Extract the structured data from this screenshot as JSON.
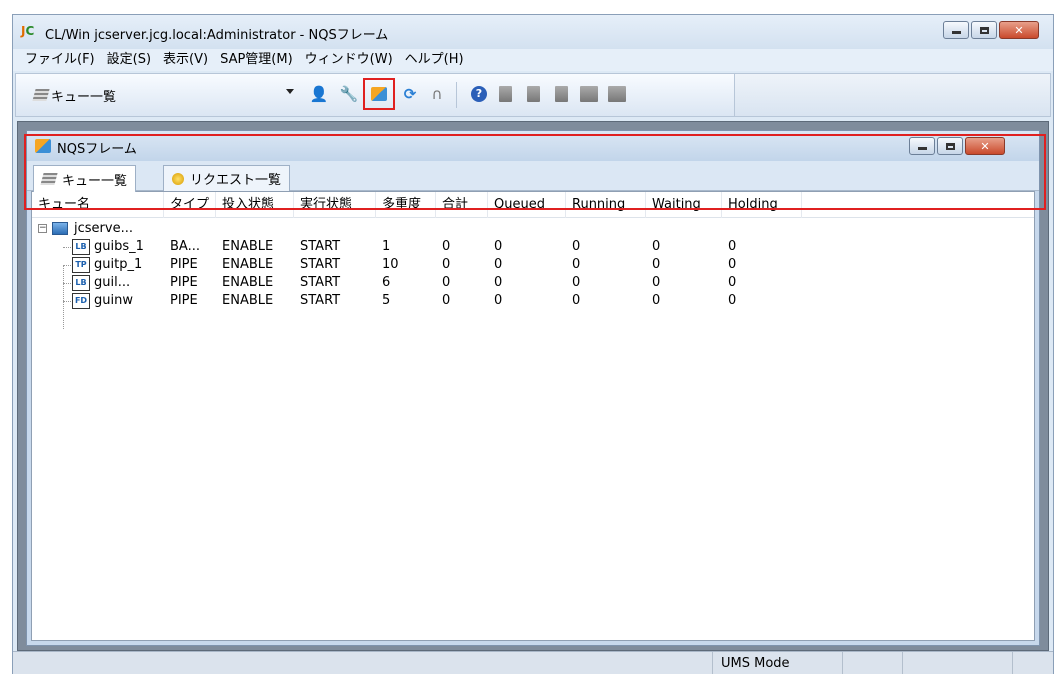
{
  "window": {
    "logo": "JC",
    "title": "CL/Win jcserver.jcg.local:Administrator - NQSフレーム"
  },
  "menu": [
    "ファイル(F)",
    "設定(S)",
    "表示(V)",
    "SAP管理(M)",
    "ウィンドウ(W)",
    "ヘルプ(H)"
  ],
  "toolbar": {
    "combo_value": "キュー一覧",
    "buttons": [
      "user-icon",
      "tools-icon",
      "nqs-frame-icon",
      "refresh-icon",
      "stop-icon",
      "help-icon",
      "doc-icon",
      "doc2-icon",
      "doc3-icon",
      "job-icon",
      "transfer-icon"
    ]
  },
  "inner": {
    "title": "NQSフレーム",
    "tabs": [
      {
        "label": "キュー一覧",
        "active": true
      },
      {
        "label": "リクエスト一覧",
        "active": false
      }
    ]
  },
  "table": {
    "headers": [
      "キュー名",
      "タイプ",
      "投入状態",
      "実行状態",
      "多重度",
      "合計",
      "Queued",
      "Running",
      "Waiting",
      "Holding"
    ],
    "server": "jcserve...",
    "rows": [
      {
        "icon": "LB",
        "name": "guibs_1",
        "type": "BA...",
        "submit": "ENABLE",
        "run": "START",
        "multi": "1",
        "total": "0",
        "queued": "0",
        "running": "0",
        "waiting": "0",
        "holding": "0"
      },
      {
        "icon": "TP",
        "name": "guitp_1",
        "type": "PIPE",
        "submit": "ENABLE",
        "run": "START",
        "multi": "10",
        "total": "0",
        "queued": "0",
        "running": "0",
        "waiting": "0",
        "holding": "0"
      },
      {
        "icon": "LB",
        "name": "guil...",
        "type": "PIPE",
        "submit": "ENABLE",
        "run": "START",
        "multi": "6",
        "total": "0",
        "queued": "0",
        "running": "0",
        "waiting": "0",
        "holding": "0"
      },
      {
        "icon": "FD",
        "name": "guinw",
        "type": "PIPE",
        "submit": "ENABLE",
        "run": "START",
        "multi": "5",
        "total": "0",
        "queued": "0",
        "running": "0",
        "waiting": "0",
        "holding": "0"
      }
    ]
  },
  "status": {
    "mode": "UMS Mode"
  },
  "colors": {
    "highlight": "#e02020",
    "mdi_bg": "#7f8c9c"
  }
}
